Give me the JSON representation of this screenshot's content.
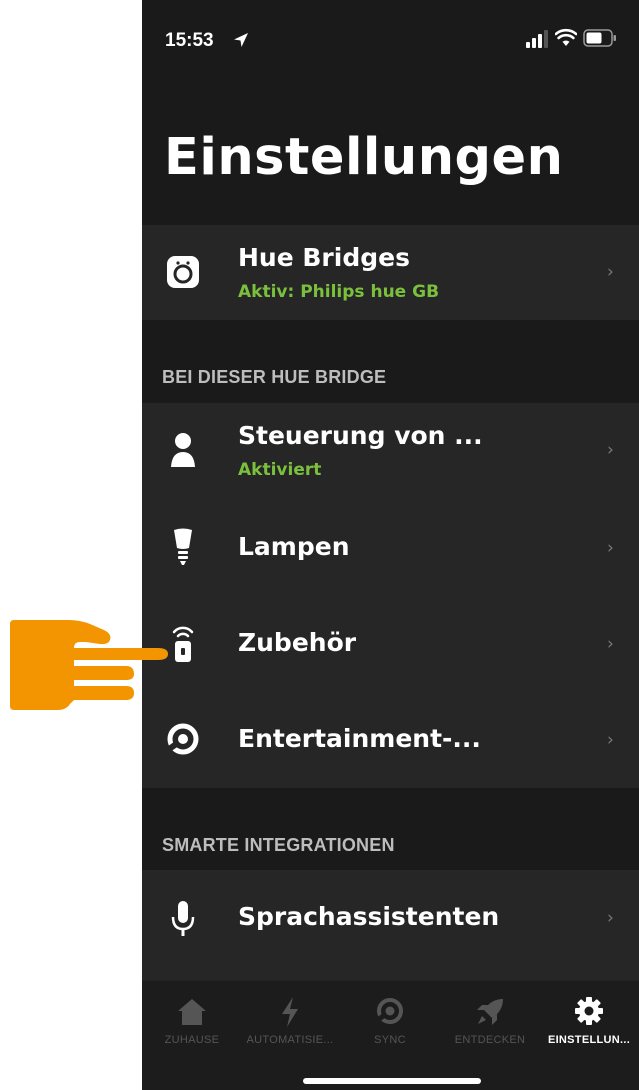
{
  "status_bar": {
    "time": "15:53"
  },
  "page": {
    "title": "Einstellungen"
  },
  "bridge_row": {
    "title": "Hue Bridges",
    "subtitle": "Aktiv: Philips hue GB",
    "chevron": "›"
  },
  "sections": [
    {
      "header": "BEI DIESER HUE BRIDGE",
      "items": [
        {
          "icon": "person-icon",
          "title": "Steuerung von ...",
          "subtitle": "Aktiviert"
        },
        {
          "icon": "lamp-icon",
          "title": "Lampen"
        },
        {
          "icon": "remote-icon",
          "title": "Zubehör"
        },
        {
          "icon": "entertainment-icon",
          "title": "Entertainment-..."
        }
      ]
    },
    {
      "header": "SMARTE INTEGRATIONEN",
      "items": [
        {
          "icon": "microphone-icon",
          "title": "Sprachassistenten"
        }
      ]
    }
  ],
  "tabbar": {
    "tabs": [
      {
        "label": "ZUHAUSE",
        "icon": "home-icon",
        "active": false
      },
      {
        "label": "AUTOMATISIE...",
        "icon": "lightning-icon",
        "active": false
      },
      {
        "label": "SYNC",
        "icon": "sync-icon",
        "active": false
      },
      {
        "label": "ENTDECKEN",
        "icon": "rocket-icon",
        "active": false
      },
      {
        "label": "EINSTELLUN...",
        "icon": "gear-icon",
        "active": true
      }
    ]
  },
  "colors": {
    "accent_green": "#7bc03c",
    "pointer_orange": "#f29500",
    "background": "#1a1a1a",
    "row": "#262626"
  }
}
